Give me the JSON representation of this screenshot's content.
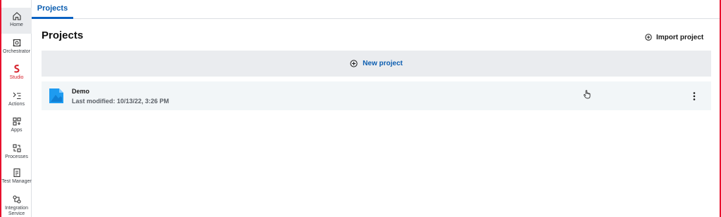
{
  "sidebar": {
    "items": [
      {
        "label": "Home",
        "icon": "home-icon"
      },
      {
        "label": "Orchestrator",
        "icon": "orchestrator-icon"
      },
      {
        "label": "Studio",
        "icon": "studio-icon"
      },
      {
        "label": "Actions",
        "icon": "actions-icon"
      },
      {
        "label": "Apps",
        "icon": "apps-icon"
      },
      {
        "label": "Processes",
        "icon": "processes-icon"
      },
      {
        "label": "Test Manager",
        "icon": "test-manager-icon"
      },
      {
        "label": "Integration Service",
        "icon": "integration-service-icon"
      }
    ]
  },
  "tabs": [
    {
      "label": "Projects"
    }
  ],
  "main": {
    "title": "Projects",
    "import_label": "Import project",
    "new_project_label": "New project"
  },
  "projects": [
    {
      "name": "Demo",
      "last_modified": "Last modified: 10/13/22, 3:26 PM"
    }
  ],
  "colors": {
    "accent": "#0b62c2",
    "studio": "#d6202b",
    "frame": "#e8112d"
  }
}
